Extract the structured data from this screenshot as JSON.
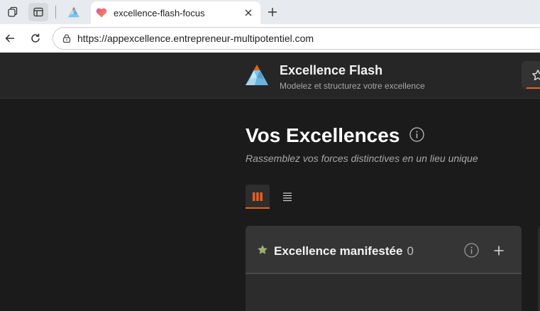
{
  "browser": {
    "active_tab": {
      "title": "excellence-flash-focus",
      "favicon": "heart-gradient-icon"
    },
    "inactive_tab": {
      "favicon": "app-logo-icon"
    },
    "address_bar": {
      "url": "https://appexcellence.entrepreneur-multipotentiel.com"
    }
  },
  "app": {
    "brand": {
      "title": "Excellence Flash",
      "subtitle": "Modelez et structurez votre excellence"
    },
    "page": {
      "title": "Vos Excellences",
      "subtitle": "Rassemblez vos forces distinctives en un lieu unique"
    },
    "views": {
      "active": "board"
    },
    "columns": [
      {
        "title": "Excellence manifestée",
        "count": "0",
        "icon": "star-icon"
      }
    ],
    "colors": {
      "accent": "#e8601c",
      "background": "#1b1b1b",
      "header": "#262626",
      "column": "#2c2c2c"
    }
  }
}
